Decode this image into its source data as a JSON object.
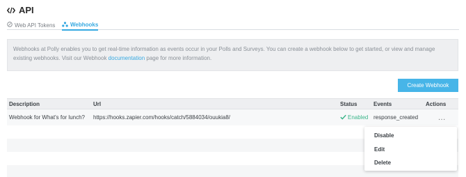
{
  "header": {
    "title": "API",
    "icon": "code-icon"
  },
  "tabs": [
    {
      "label": "Web API Tokens",
      "icon": "link-icon",
      "active": false
    },
    {
      "label": "Webhooks",
      "icon": "webhook-icon",
      "active": true
    }
  ],
  "info": {
    "text_before": "Webhooks at Polly enables you to get real-time information as events occur in your Polls and Surveys.  You can create a webhook below to get started, or view and manage existing webhooks.  Visit our Webhook ",
    "link": "documentation",
    "text_after": " page for more information."
  },
  "create_button": "Create Webhook",
  "table": {
    "columns": [
      "Description",
      "Url",
      "Status",
      "Events",
      "Actions"
    ],
    "rows": [
      {
        "description": "Webhook for What's for lunch?",
        "url": "https://hooks.zapier.com/hooks/catch/5884034/ouukia8/",
        "status": "Enabled",
        "events": "response_created",
        "actions": "..."
      }
    ]
  },
  "dropdown": {
    "items": [
      "Disable",
      "Edit",
      "Delete"
    ]
  },
  "colors": {
    "accent": "#36a9e1",
    "button": "#47b5e8",
    "enabled": "#3bb58a"
  }
}
